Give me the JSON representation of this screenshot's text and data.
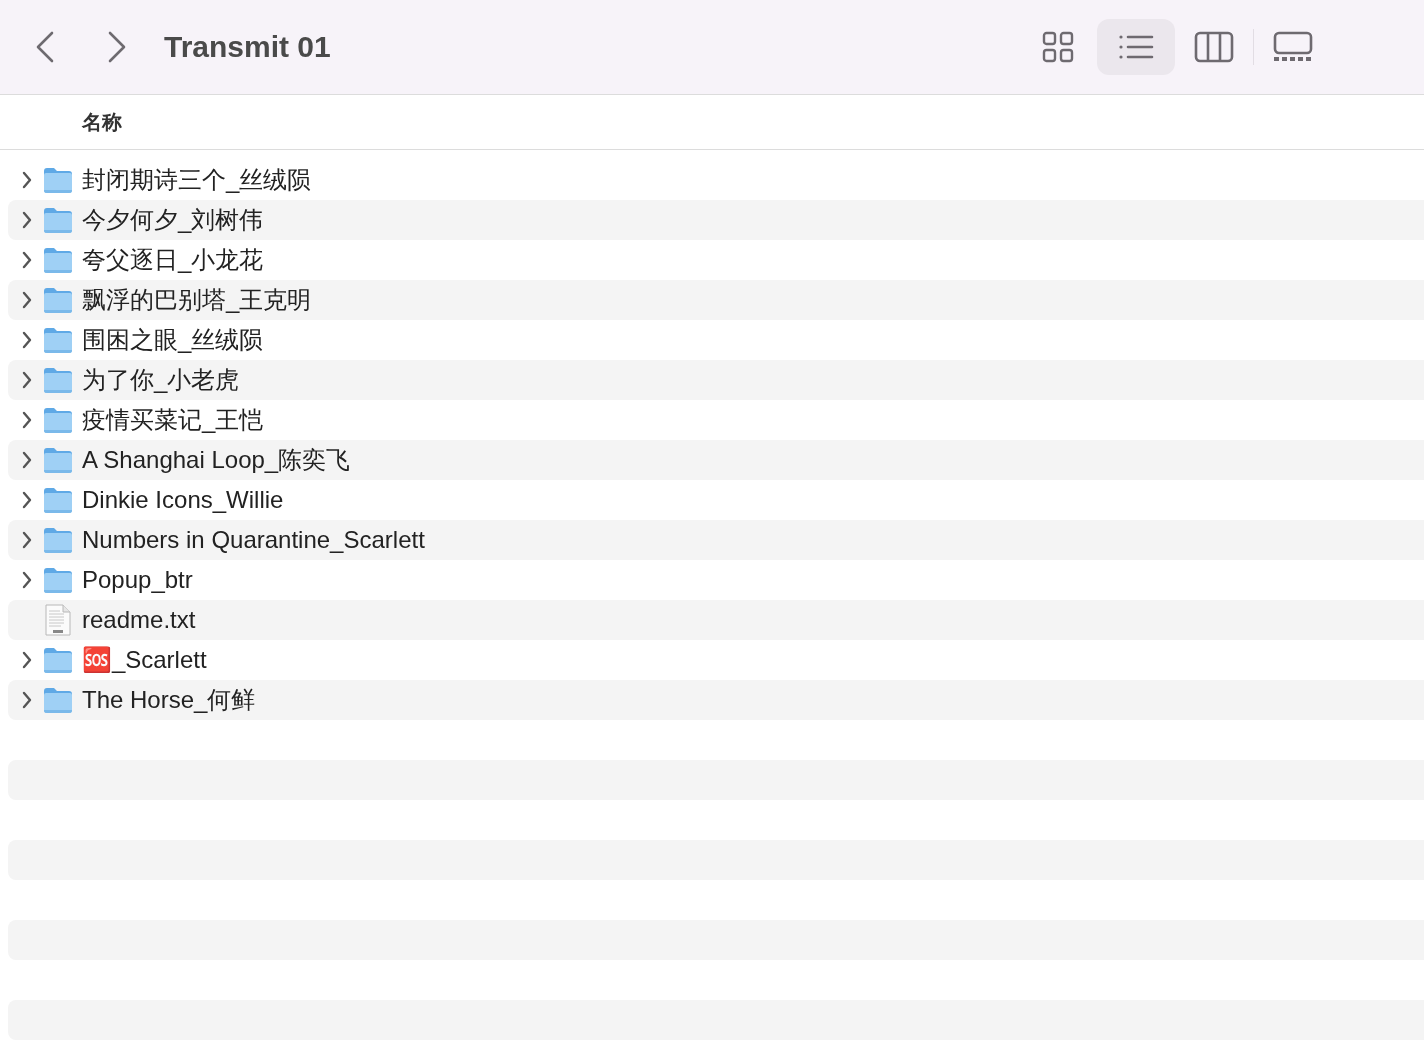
{
  "window": {
    "title": "Transmit 01"
  },
  "toolbar": {
    "view_buttons": [
      {
        "kind": "icons",
        "selected": false
      },
      {
        "kind": "list",
        "selected": true
      },
      {
        "kind": "columns",
        "selected": false
      },
      {
        "kind": "gallery",
        "selected": false
      }
    ]
  },
  "table": {
    "columns": [
      "名称"
    ],
    "rows": [
      {
        "name": "封闭期诗三个_丝绒陨",
        "kind": "folder",
        "expanded": false
      },
      {
        "name": "今夕何夕_刘树伟",
        "kind": "folder",
        "expanded": false
      },
      {
        "name": "夸父逐日_小龙花",
        "kind": "folder",
        "expanded": false
      },
      {
        "name": "飘浮的巴别塔_王克明",
        "kind": "folder",
        "expanded": false
      },
      {
        "name": "围困之眼_丝绒陨",
        "kind": "folder",
        "expanded": false
      },
      {
        "name": "为了你_小老虎",
        "kind": "folder",
        "expanded": false
      },
      {
        "name": "疫情买菜记_王恺",
        "kind": "folder",
        "expanded": false
      },
      {
        "name": "A Shanghai Loop_陈奕飞",
        "kind": "folder",
        "expanded": false
      },
      {
        "name": "Dinkie Icons_Willie",
        "kind": "folder",
        "expanded": false
      },
      {
        "name": "Numbers in Quarantine_Scarlett",
        "kind": "folder",
        "expanded": false
      },
      {
        "name": "Popup_btr",
        "kind": "folder",
        "expanded": false
      },
      {
        "name": "readme.txt",
        "kind": "text-file"
      },
      {
        "name": "🆘_Scarlett",
        "kind": "folder",
        "expanded": false
      },
      {
        "name": "The Horse_何鲜",
        "kind": "folder",
        "expanded": false
      }
    ]
  }
}
